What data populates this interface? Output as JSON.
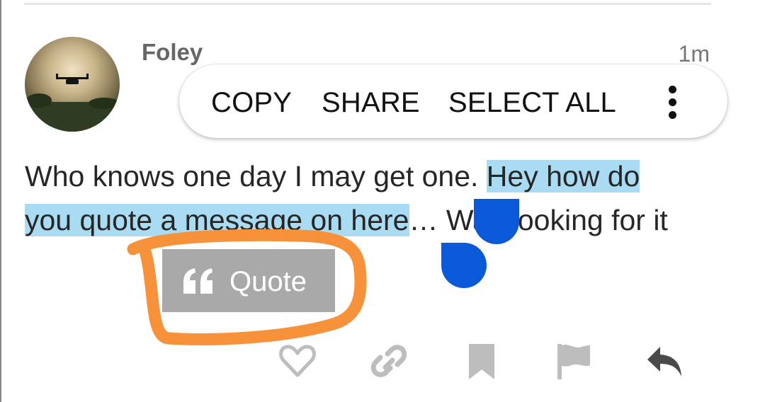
{
  "post": {
    "author": "Foley",
    "time": "1m",
    "text_plain": "Who knows one day I may get one. ",
    "text_highlighted_1": "Hey how do",
    "text_highlighted_2": "you quote a message on here",
    "text_after": "… Was looking for it"
  },
  "selection_toolbar": {
    "copy": "COPY",
    "share": "SHARE",
    "select_all": "SELECT ALL",
    "more_icon": "more-vertical-icon"
  },
  "quote_button": {
    "label": "Quote",
    "icon": "quote-icon"
  },
  "actions": [
    {
      "name": "like",
      "icon": "heart-icon"
    },
    {
      "name": "copy-link",
      "icon": "link-icon"
    },
    {
      "name": "bookmark",
      "icon": "bookmark-icon"
    },
    {
      "name": "flag",
      "icon": "flag-icon"
    },
    {
      "name": "reply",
      "icon": "reply-icon"
    }
  ],
  "colors": {
    "selection_highlight": "#a9dcf3",
    "selection_handle": "#0a59d8",
    "quote_button_bg": "#a9a9a9",
    "annotation_orange": "#f7923a",
    "action_icon": "#bdbdbd",
    "reply_icon": "#4a4a4a"
  }
}
